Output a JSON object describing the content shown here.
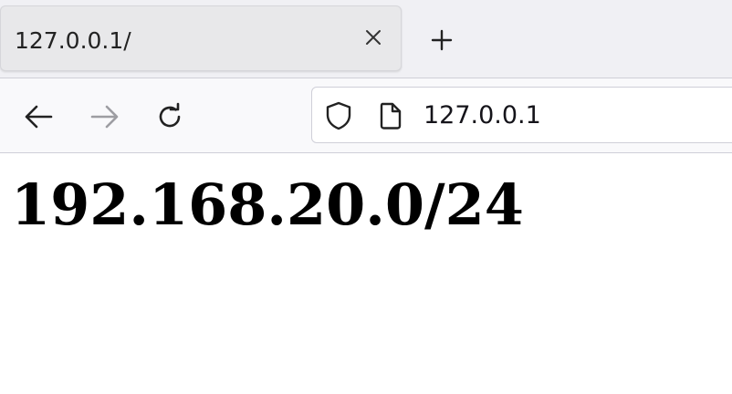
{
  "tab": {
    "title": "127.0.0.1/",
    "close_icon": "close-icon"
  },
  "toolbar": {
    "new_tab_icon": "plus-icon",
    "back_icon": "arrow-left-icon",
    "forward_icon": "arrow-right-icon",
    "reload_icon": "reload-icon"
  },
  "urlbar": {
    "shield_icon": "shield-icon",
    "page_icon": "page-icon",
    "url": "127.0.0.1"
  },
  "page": {
    "heading": "192.168.20.0/24"
  },
  "colors": {
    "tabstrip_bg": "#f0f0f4",
    "tab_bg": "#e8e8ea",
    "navbar_bg": "#f9f9fb",
    "forward_disabled": "#9d9da2"
  }
}
